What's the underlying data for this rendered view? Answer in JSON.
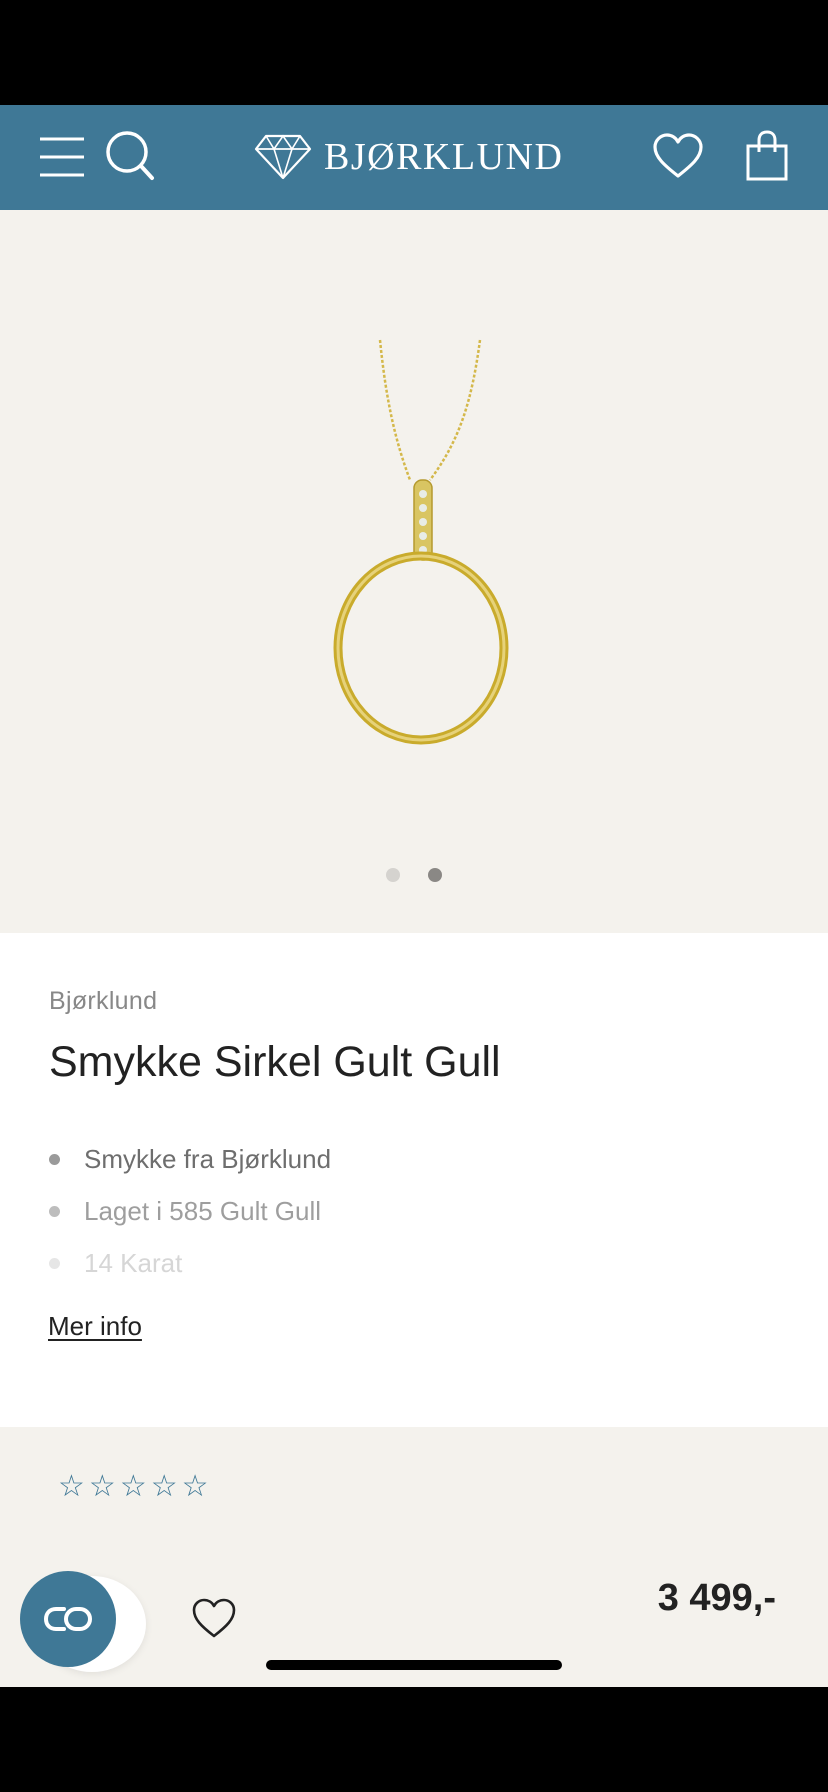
{
  "header": {
    "brand_name": "BJØRKLUND",
    "icons": [
      "menu-icon",
      "search-icon",
      "diamond-logo-icon",
      "heart-icon",
      "shopping-bag-icon"
    ],
    "color": "#3f7896"
  },
  "gallery": {
    "image": "gold circle necklace pendant",
    "slide_count": 2,
    "active_slide": 2
  },
  "product": {
    "brand": "Bjørklund",
    "title": "Smykke Sirkel Gult Gull",
    "features": [
      "Smykke fra Bjørklund",
      "Laget i 585 Gult Gull",
      "14 Karat"
    ],
    "more_info_label": "Mer info"
  },
  "reviews": {
    "rating": 0,
    "max_rating": 5
  },
  "purchase": {
    "price": "3 499,-"
  }
}
